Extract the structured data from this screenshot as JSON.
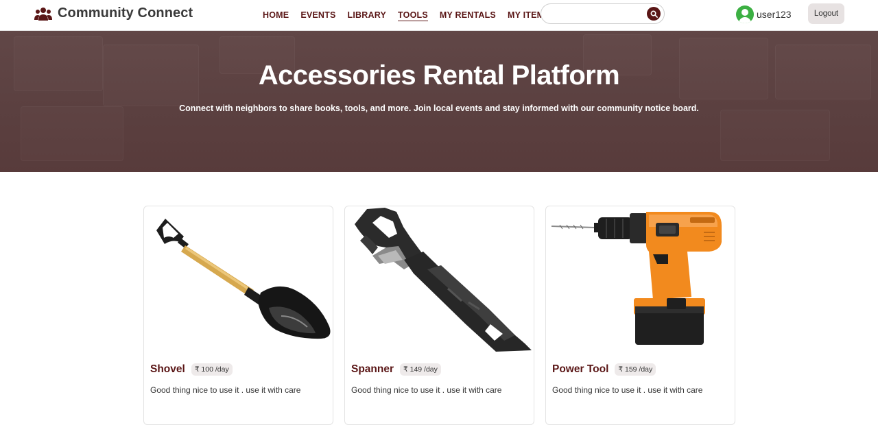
{
  "brand": {
    "name": "Community Connect",
    "icon": "users-icon",
    "color": "#5a1616"
  },
  "nav": {
    "links": [
      {
        "label": "HOME",
        "active": false
      },
      {
        "label": "EVENTS",
        "active": false
      },
      {
        "label": "LIBRARY",
        "active": false
      },
      {
        "label": "TOOLS",
        "active": true
      },
      {
        "label": "MY RENTALS",
        "active": false
      },
      {
        "label": "MY ITEMS",
        "active": false
      }
    ]
  },
  "search": {
    "value": "",
    "placeholder": "",
    "icon": "search-icon"
  },
  "user": {
    "name": "user123",
    "avatar_color": "#3cb043"
  },
  "logout_label": "Logout",
  "hero": {
    "title": "Accessories Rental Platform",
    "subtitle": "Connect with neighbors to share books, tools, and more. Join local events and stay informed with our community notice board."
  },
  "items": [
    {
      "name": "Shovel",
      "price": "₹ 100 /day",
      "description": "Good thing nice to use it . use it with care"
    },
    {
      "name": "Spanner",
      "price": "₹ 149 /day",
      "description": "Good thing nice to use it . use it with care"
    },
    {
      "name": "Power Tool",
      "price": "₹ 159 /day",
      "description": "Good thing nice to use it . use it with care"
    }
  ]
}
